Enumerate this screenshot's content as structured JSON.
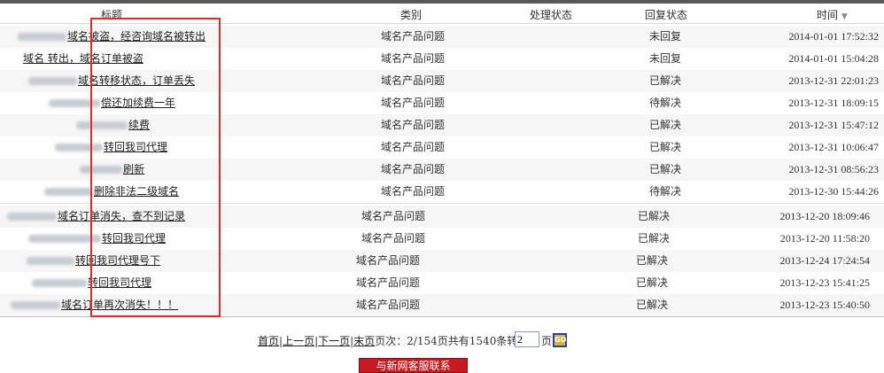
{
  "table": {
    "headers": {
      "title": "标题",
      "category": "类别",
      "process_status": "处理状态",
      "reply_status": "回复状态",
      "time": "时间"
    },
    "sort_indicator": "▼",
    "rows": [
      {
        "title": "域名被盗，经咨询域名被转出",
        "category": "域名产品问题",
        "reply": "未回复",
        "time": "2014-01-01 17:52:32"
      },
      {
        "title": "域名  转出，域名订单被盗",
        "category": "域名产品问题",
        "reply": "未回复",
        "time": "2014-01-01 15:04:28"
      },
      {
        "title": "域名转移状态，订单丢失",
        "category": "域名产品问题",
        "reply": "已解决",
        "time": "2013-12-31 22:01:23"
      },
      {
        "title": "偿还加续费一年",
        "category": "域名产品问题",
        "reply": "待解决",
        "time": "2013-12-31 18:09:15"
      },
      {
        "title": "续费",
        "category": "域名产品问题",
        "reply": "已解决",
        "time": "2013-12-31 15:47:12"
      },
      {
        "title": "转回我司代理",
        "category": "域名产品问题",
        "reply": "已解决",
        "time": "2013-12-31 10:06:47"
      },
      {
        "title": "刷新",
        "category": "域名产品问题",
        "reply": "已解决",
        "time": "2013-12-31 08:56:23"
      },
      {
        "title": "删除非法二级域名",
        "category": "域名产品问题",
        "reply": "待解决",
        "time": "2013-12-30 15:44:26"
      },
      {
        "title": "域名订单消失，查不到记录",
        "category": "域名产品问题",
        "reply": "已解决",
        "time": "2013-12-20 18:09:46"
      },
      {
        "title": "转回我司代理",
        "category": "域名产品问题",
        "reply": "已解决",
        "time": "2013-12-20 11:58:20"
      },
      {
        "title": "转回我司代理号下",
        "category": "域名产品问题",
        "reply": "已解决",
        "time": "2013-12-24 17:24:54"
      },
      {
        "title": "转回我司代理",
        "category": "域名产品问题",
        "reply": "已解决",
        "time": "2013-12-23 15:41:25"
      },
      {
        "title": "域名订单再次消失！！！",
        "category": "域名产品问题",
        "reply": "已解决",
        "time": "2013-12-23 15:40:50"
      }
    ]
  },
  "pager": {
    "first": "首页",
    "prev": "上一页",
    "next": "下一页",
    "last": "末页",
    "summary": "页次：2/154页共有1540条转到",
    "page_value": "2",
    "page_suffix": "页",
    "go_label": "GO"
  },
  "contact_button": "与新网客服联系",
  "colors": {
    "highlight_box": "#e8272a",
    "contact_button": "#c9181e"
  }
}
